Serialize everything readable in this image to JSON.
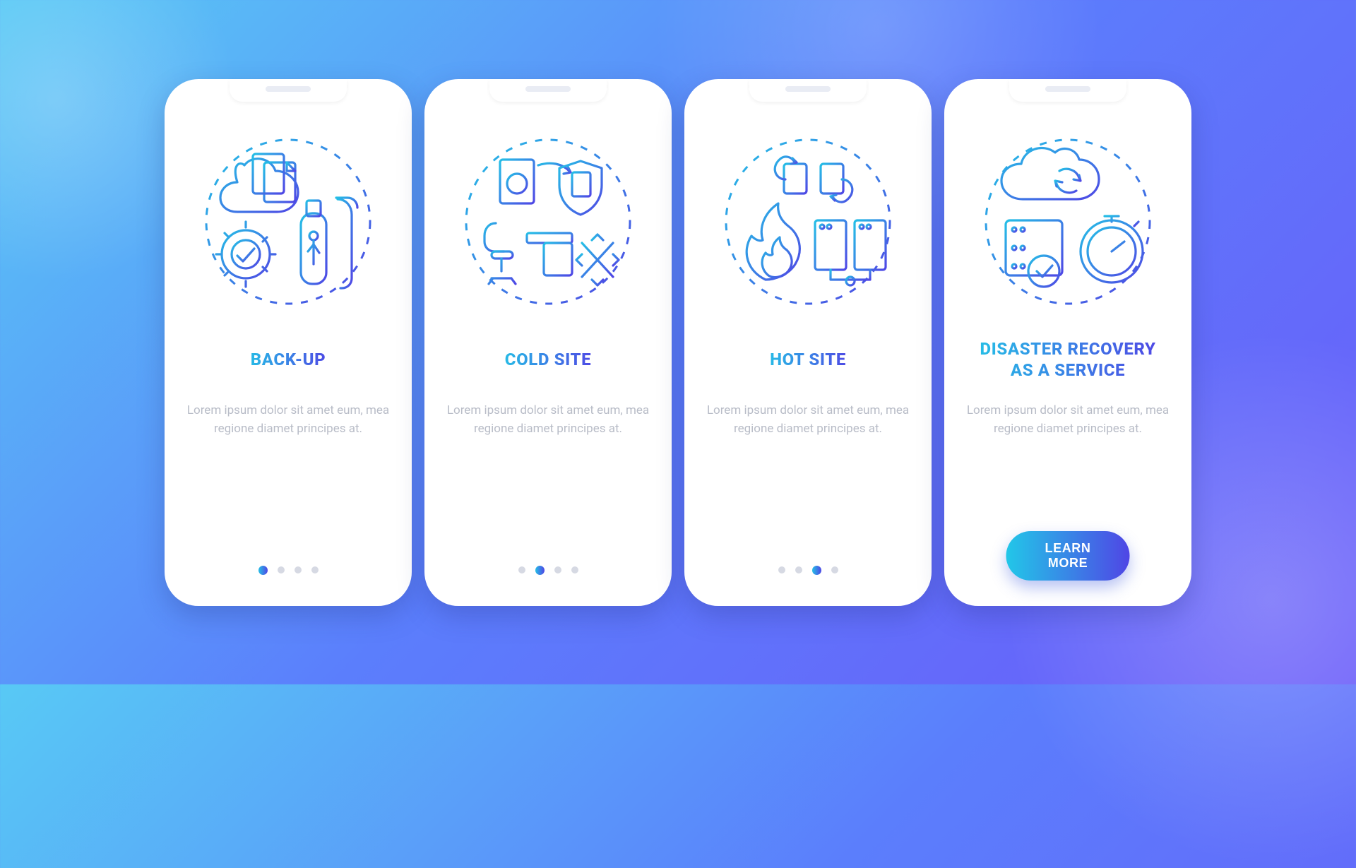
{
  "cards": [
    {
      "id": "backup",
      "title": "BACK-UP",
      "desc": "Lorem ipsum dolor sit amet eum, mea regione diamet principes at.",
      "active_index": 0,
      "icon": "backup-icon"
    },
    {
      "id": "cold-site",
      "title": "COLD SITE",
      "desc": "Lorem ipsum dolor sit amet eum, mea regione diamet principes at.",
      "active_index": 1,
      "icon": "cold-site-icon"
    },
    {
      "id": "hot-site",
      "title": "HOT SITE",
      "desc": "Lorem ipsum dolor sit amet eum, mea regione diamet principes at.",
      "active_index": 2,
      "icon": "hot-site-icon"
    },
    {
      "id": "draas",
      "title": "DISASTER RECOVERY\nAS A SERVICE",
      "desc": "Lorem ipsum dolor sit amet eum, mea regione diamet principes at.",
      "active_index": 3,
      "icon": "draas-icon",
      "cta": "LEARN MORE"
    }
  ],
  "dot_count": 4,
  "colors": {
    "grad_from": "#25bfe6",
    "grad_to": "#4f46e5"
  }
}
